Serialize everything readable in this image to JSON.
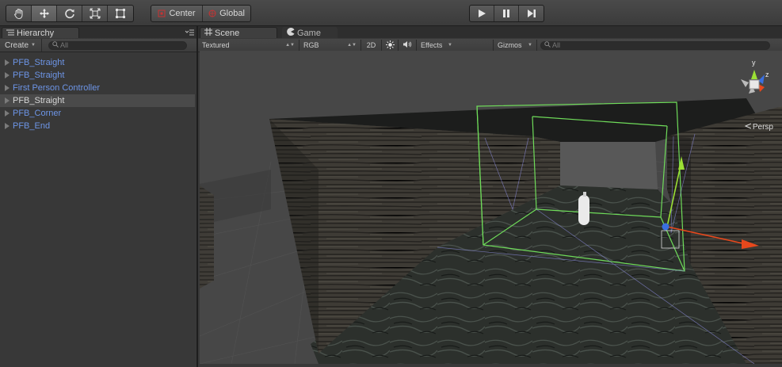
{
  "toolbar": {
    "tools": [
      {
        "name": "hand-tool",
        "icon": "hand-icon"
      },
      {
        "name": "move-tool",
        "icon": "move-arrows-icon"
      },
      {
        "name": "rotate-tool",
        "icon": "rotate-icon"
      },
      {
        "name": "scale-tool",
        "icon": "scale-icon"
      },
      {
        "name": "rect-tool",
        "icon": "rect-icon"
      }
    ],
    "pivot_label": "Center",
    "space_label": "Global",
    "playback": [
      "play-icon",
      "pause-icon",
      "step-icon"
    ]
  },
  "hierarchy": {
    "tab_label": "Hierarchy",
    "create_label": "Create",
    "search_placeholder": "All",
    "items": [
      {
        "label": "PFB_Straight",
        "selected": false
      },
      {
        "label": "PFB_Straight",
        "selected": false
      },
      {
        "label": "First Person Controller",
        "selected": false
      },
      {
        "label": "PFB_Straight",
        "selected": true
      },
      {
        "label": "PFB_Corner",
        "selected": false
      },
      {
        "label": "PFB_End",
        "selected": false
      }
    ]
  },
  "scene": {
    "tabs": [
      {
        "label": "Scene",
        "icon": "scene-grid-icon",
        "active": true
      },
      {
        "label": "Game",
        "icon": "game-pacman-icon",
        "active": false
      }
    ],
    "render_mode": "Textured",
    "color_mode": "RGB",
    "toggle_2d": "2D",
    "effects_label": "Effects",
    "gizmos_label": "Gizmos",
    "search_placeholder": "All",
    "gizmo_axes": {
      "y": "y",
      "z": "z"
    },
    "projection_label": "Persp",
    "colors": {
      "x_axis": "#e8481c",
      "y_axis": "#9be034",
      "z_axis": "#3a6fe0",
      "selection": "#6fdc5a"
    }
  }
}
